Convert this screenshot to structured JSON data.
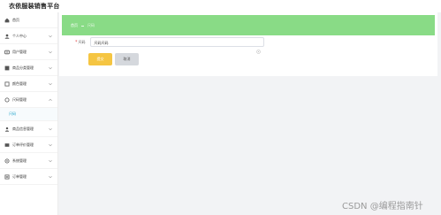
{
  "app": {
    "title": "衣依服装销售平台"
  },
  "sidebar": {
    "items": [
      {
        "label": "首页",
        "icon": "home-icon",
        "expandable": false
      },
      {
        "label": "个人中心",
        "icon": "user-icon",
        "expandable": true
      },
      {
        "label": "用户管理",
        "icon": "users-icon",
        "expandable": true
      },
      {
        "label": "商品分类管理",
        "icon": "category-icon",
        "expandable": true
      },
      {
        "label": "颜色管理",
        "icon": "palette-icon",
        "expandable": true
      },
      {
        "label": "尺码管理",
        "icon": "ruler-icon",
        "expandable": true,
        "expanded": true
      },
      {
        "label": "商品信息管理",
        "icon": "goods-icon",
        "expandable": true
      },
      {
        "label": "订单评价管理",
        "icon": "comment-icon",
        "expandable": true
      },
      {
        "label": "系统管理",
        "icon": "settings-icon",
        "expandable": true
      },
      {
        "label": "订单管理",
        "icon": "order-icon",
        "expandable": true
      }
    ],
    "sub_item": {
      "label": "尺码"
    }
  },
  "breadcrumb": {
    "root": "首页",
    "current": "尺码"
  },
  "form": {
    "field_label": "尺码",
    "field_value": "尺码尺码",
    "required": "*"
  },
  "buttons": {
    "submit": "提交",
    "cancel": "取消"
  },
  "watermark": "CSDN @编程指南针",
  "colors": {
    "accent": "#89db86",
    "submit": "#f5c542",
    "link": "#18a0c8"
  }
}
